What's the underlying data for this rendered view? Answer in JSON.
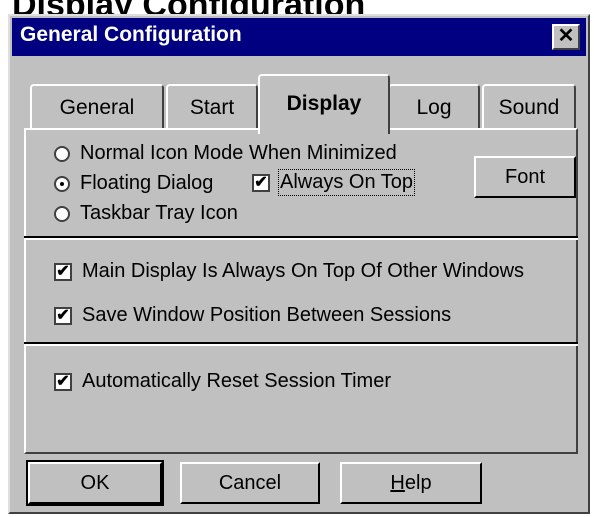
{
  "page_heading": "Display Configuration",
  "window": {
    "title": "General Configuration",
    "close_symbol": "✕"
  },
  "tabs": [
    {
      "label": "General",
      "active": false
    },
    {
      "label": "Start",
      "active": false
    },
    {
      "label": "Display",
      "active": true
    },
    {
      "label": "Log",
      "active": false
    },
    {
      "label": "Sound",
      "active": false
    }
  ],
  "display_mode": {
    "options": [
      {
        "label": "Normal Icon Mode When Minimized",
        "selected": false
      },
      {
        "label": "Floating Dialog",
        "selected": true
      },
      {
        "label": "Taskbar Tray Icon",
        "selected": false
      }
    ],
    "always_on_top": {
      "label": "Always On Top",
      "checked": true
    }
  },
  "font_button": "Font",
  "checkboxes": {
    "main_display_on_top": {
      "label": "Main Display Is Always On Top Of Other Windows",
      "checked": true
    },
    "save_window_position": {
      "label": "Save Window Position Between Sessions",
      "checked": true
    },
    "auto_reset_timer": {
      "label": "Automatically Reset Session Timer",
      "checked": true
    }
  },
  "buttons": {
    "ok": "OK",
    "cancel": "Cancel",
    "help_first": "H",
    "help_rest": "elp"
  },
  "check_mark": "✔"
}
